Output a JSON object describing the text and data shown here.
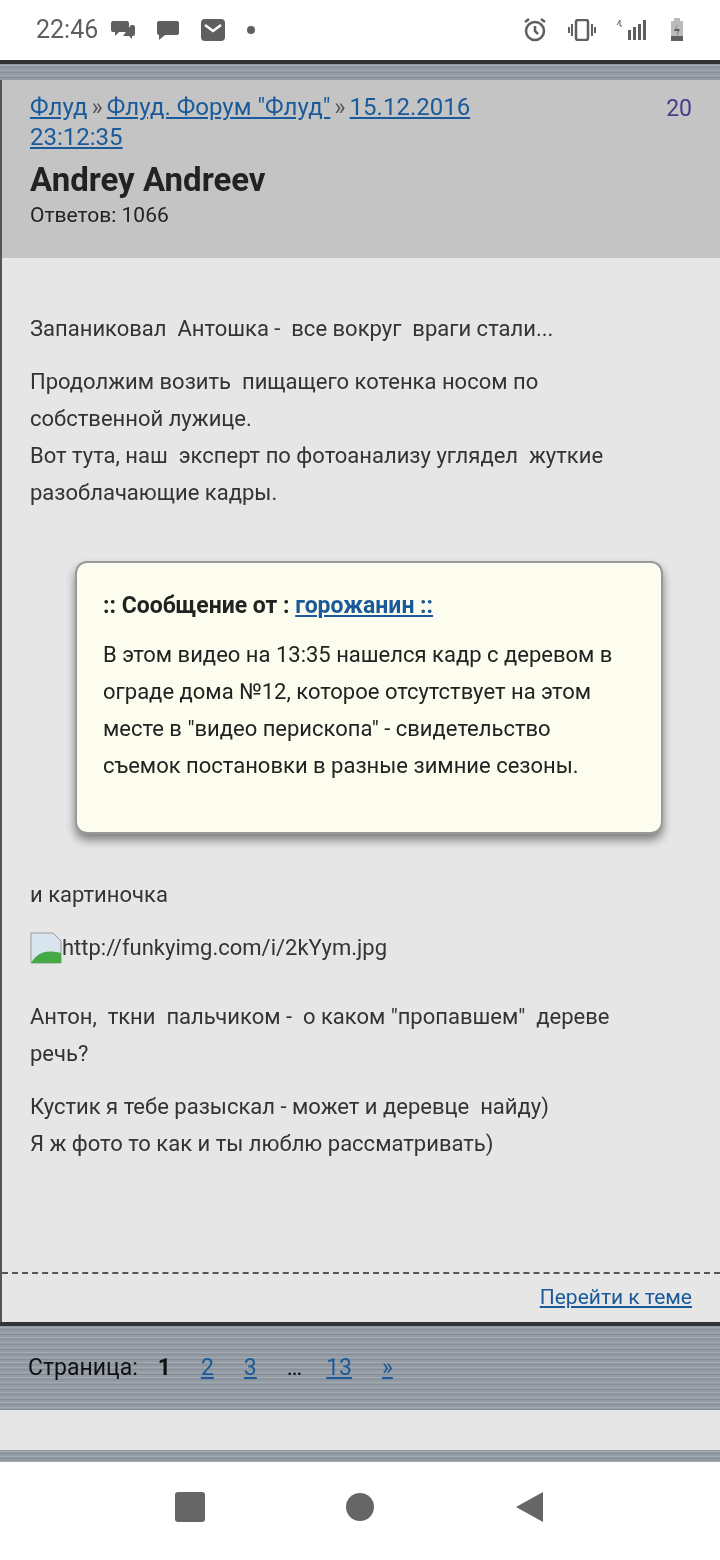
{
  "status_bar": {
    "time": "22:46"
  },
  "post": {
    "breadcrumbs": [
      {
        "label": "Флуд"
      },
      {
        "label": "Флуд. Форум \"Флуд\""
      },
      {
        "label": "15.12.2016"
      }
    ],
    "date_link_continued": "23:12:35",
    "separator": "»",
    "number": "20",
    "author": "Andrey Andreev",
    "replies": "Ответов: 1066",
    "body": [
      {
        "kind": "text",
        "text": "Запаниковал  Антошка -  все вокруг  враги стали..."
      },
      {
        "kind": "text",
        "text": "Продолжим возить  пищащего котенка носом по собственной лужице.\nВот тута, наш  эксперт по фотоанализу углядел  жуткие разоблачающие кадры."
      },
      {
        "kind": "quote",
        "prefix": ":: Сообщение от :",
        "author": "горожанин ::",
        "text": "В этом видео на 13:35 нашелся кадр с деревом в ограде дома №12, которое отсутствует на этом месте в \"видео перископа\" - свидетельство съемок постановки в разные зимние сезоны."
      },
      {
        "kind": "text",
        "text": "и картиночка"
      },
      {
        "kind": "image",
        "alt": "http://funkyimg.com/i/2kYym.jpg"
      },
      {
        "kind": "text",
        "text": "Антон,  ткни  пальчиком -  о каком \"пропавшем\"  дереве речь?"
      },
      {
        "kind": "text",
        "text": "Кустик я тебе разыскал - может и деревце  найду)\nЯ ж фото то как и ты люблю рассматривать)"
      }
    ],
    "footer_link": "Перейти к теме"
  },
  "pagination": {
    "label": "Страница:",
    "pages": [
      {
        "label": "1",
        "selected": true
      },
      {
        "label": "2",
        "selected": false
      },
      {
        "label": "3",
        "selected": false
      },
      {
        "label": "…",
        "kind": "gap"
      },
      {
        "label": "13",
        "selected": false
      },
      {
        "label": "»",
        "selected": false
      }
    ]
  }
}
